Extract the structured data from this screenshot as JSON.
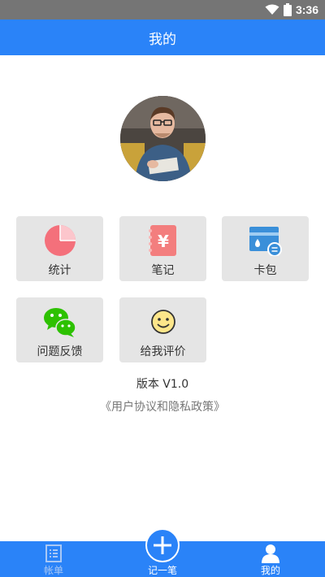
{
  "status_bar": {
    "time": "3:36",
    "icons": [
      "wifi-icon",
      "battery-icon"
    ]
  },
  "header": {
    "title": "我的"
  },
  "profile": {
    "avatar_icon": "user-avatar-photo"
  },
  "tiles": [
    {
      "label": "统计",
      "icon": "pie-chart-icon"
    },
    {
      "label": "笔记",
      "icon": "yen-note-icon"
    },
    {
      "label": "卡包",
      "icon": "card-wallet-icon"
    },
    {
      "label": "问题反馈",
      "icon": "wechat-chat-icon"
    },
    {
      "label": "给我评价",
      "icon": "smiley-icon"
    }
  ],
  "version": {
    "text": "版本 V1.0"
  },
  "agreement": {
    "text": "《用户协议和隐私政策》"
  },
  "bottom_nav": {
    "items": [
      {
        "label": "帐单",
        "icon": "bill-icon",
        "active": false
      },
      {
        "label": "记一笔",
        "icon": "add-icon",
        "active": false
      },
      {
        "label": "我的",
        "icon": "person-icon",
        "active": true
      }
    ]
  },
  "colors": {
    "primary": "#2a83f8",
    "tile_bg": "#e5e5e5",
    "status_bar": "#757575",
    "pie": "#f4707b",
    "note": "#f37e7e",
    "card": "#3a8fd9",
    "wechat": "#2dc100"
  }
}
